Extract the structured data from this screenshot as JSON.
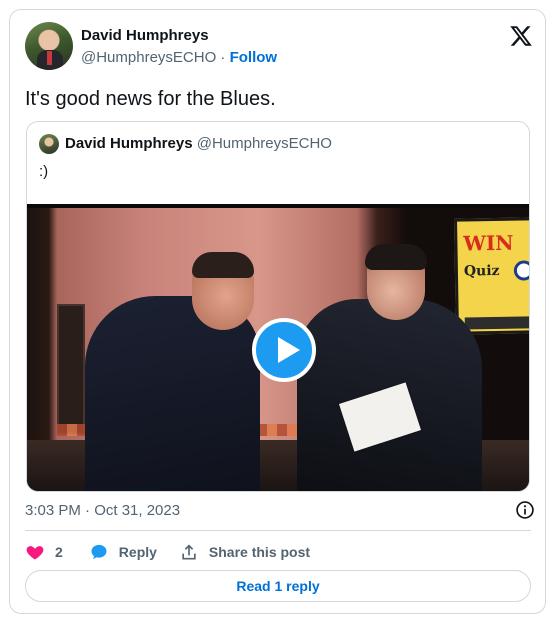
{
  "author": {
    "name": "David Humphreys",
    "handle": "@HumphreysECHO",
    "separator": " · ",
    "follow_label": "Follow"
  },
  "tweet": {
    "text": "It's good news for the Blues."
  },
  "quoted_tweet": {
    "name": "David Humphreys",
    "handle": "@HumphreysECHO",
    "text": ":)"
  },
  "video": {
    "poster_text_1": "WIN",
    "poster_text_2": "Quiz Night"
  },
  "footer": {
    "timestamp": "3:03 PM · Oct 31, 2023"
  },
  "actions": {
    "like_count": "2",
    "reply_label": "Reply",
    "share_label": "Share this post"
  },
  "read_reply_label": "Read 1 reply",
  "colors": {
    "accent": "#1d9bf0",
    "link": "#006fd6",
    "like": "#f91880",
    "muted": "#536471",
    "border": "#cfd9de"
  },
  "icons": [
    "x-logo-icon",
    "info-icon",
    "heart-icon",
    "reply-bubble-icon",
    "share-icon",
    "play-icon"
  ]
}
